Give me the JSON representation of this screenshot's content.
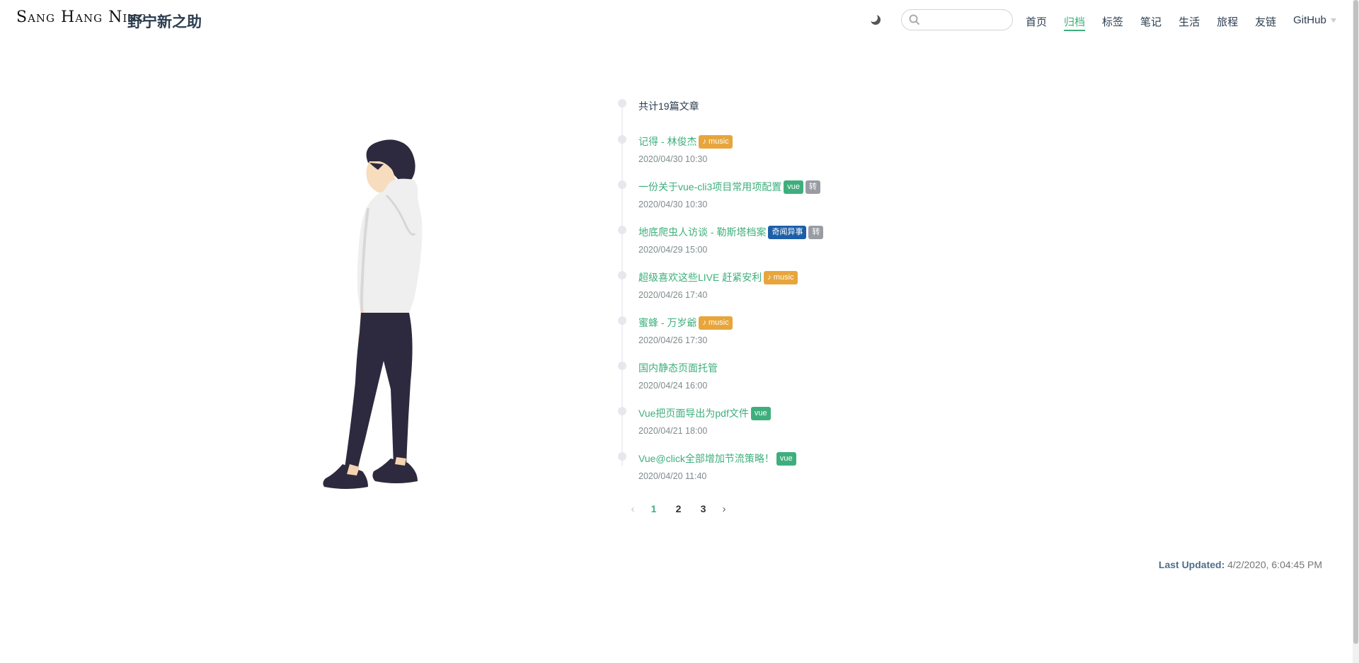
{
  "header": {
    "logo_text": "Sang Hang Ning",
    "site_name": "野宁新之助",
    "search_placeholder": "",
    "theme_icon": "moon-icon",
    "nav": [
      {
        "label": "首页"
      },
      {
        "label": "归档",
        "active": true
      },
      {
        "label": "标签"
      },
      {
        "label": "笔记"
      },
      {
        "label": "生活"
      },
      {
        "label": "旅程"
      },
      {
        "label": "友链"
      },
      {
        "label": "GitHub",
        "dropdown": true
      }
    ]
  },
  "archive": {
    "count_text": "共计19篇文章",
    "posts": [
      {
        "title": "记得 - 林俊杰",
        "date": "2020/04/30 10:30",
        "tags": [
          {
            "label": "♪ music",
            "kind": "music"
          }
        ]
      },
      {
        "title": "一份关于vue-cli3项目常用项配置",
        "date": "2020/04/30 10:30",
        "tags": [
          {
            "label": "vue",
            "kind": "vue"
          },
          {
            "label": "转",
            "kind": "zhuan"
          }
        ]
      },
      {
        "title": "地底爬虫人访谈 - 勒斯塔档案",
        "date": "2020/04/29 15:00",
        "tags": [
          {
            "label": "奇闻异事",
            "kind": "qiwen"
          },
          {
            "label": "转",
            "kind": "zhuan"
          }
        ]
      },
      {
        "title": "超级喜欢这些LIVE 赶紧安利",
        "date": "2020/04/26 17:40",
        "tags": [
          {
            "label": "♪ music",
            "kind": "music"
          }
        ]
      },
      {
        "title": "蜜蜂 - 万岁爺",
        "date": "2020/04/26 17:30",
        "tags": [
          {
            "label": "♪ music",
            "kind": "music"
          }
        ]
      },
      {
        "title": "国内静态页面托管",
        "date": "2020/04/24 16:00",
        "tags": []
      },
      {
        "title": "Vue把页面导出为pdf文件",
        "date": "2020/04/21 18:00",
        "tags": [
          {
            "label": "vue",
            "kind": "vue"
          }
        ]
      },
      {
        "title": "Vue@click全部增加节流策略！",
        "date": "2020/04/20 11:40",
        "tags": [
          {
            "label": "vue",
            "kind": "vue"
          }
        ]
      }
    ]
  },
  "pagination": {
    "prev_icon": "chevron-left-icon",
    "next_icon": "chevron-right-icon",
    "pages": [
      "1",
      "2",
      "3"
    ],
    "current": "1"
  },
  "footer": {
    "last_updated_label": "Last Updated:",
    "last_updated_value": "4/2/2020, 6:04:45 PM"
  },
  "colors": {
    "accent": "#3eaf7c",
    "music_tag": "#e7a53b",
    "vue_tag": "#3eaf7c",
    "zhuan_tag": "#999ca3",
    "qiwen_tag": "#1d5ea8"
  }
}
